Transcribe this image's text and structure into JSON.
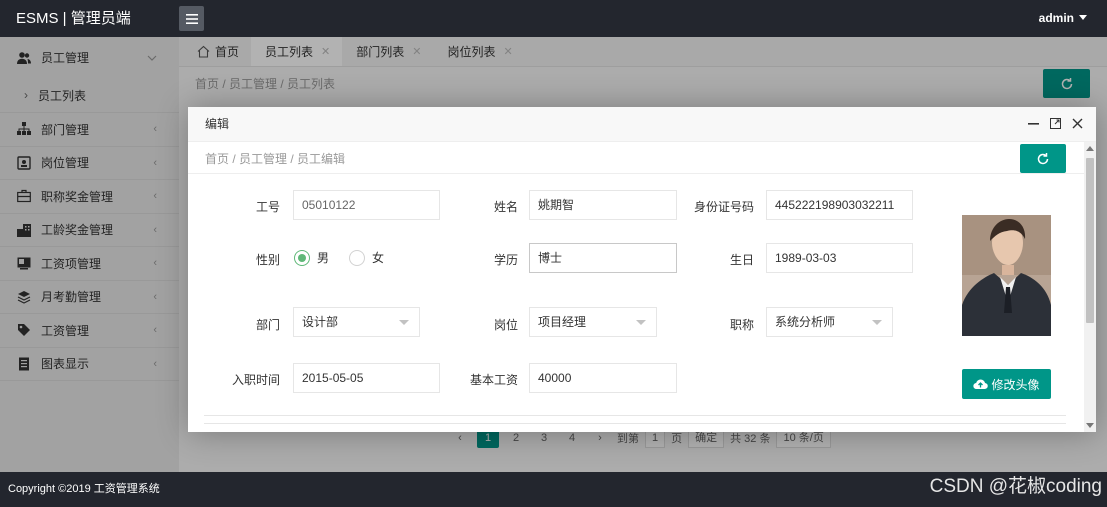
{
  "header": {
    "logo": "ESMS | 管理员端",
    "user": "admin"
  },
  "sidebar": {
    "groups": [
      {
        "label": "员工管理",
        "icon": "users-icon"
      },
      {
        "label": "部门管理",
        "icon": "sitemap-icon"
      },
      {
        "label": "岗位管理",
        "icon": "badge-icon"
      },
      {
        "label": "职称奖金管理",
        "icon": "briefcase-icon"
      },
      {
        "label": "工龄奖金管理",
        "icon": "building-icon"
      },
      {
        "label": "工资项管理",
        "icon": "card-icon"
      },
      {
        "label": "月考勤管理",
        "icon": "layers-icon"
      },
      {
        "label": "工资管理",
        "icon": "tag-icon"
      },
      {
        "label": "图表显示",
        "icon": "document-icon"
      }
    ],
    "sub_item": "员工列表"
  },
  "tabs": [
    {
      "label": "首页"
    },
    {
      "label": "员工列表"
    },
    {
      "label": "部门列表"
    },
    {
      "label": "岗位列表"
    }
  ],
  "main": {
    "breadcrumb": "首页  /  员工管理  /  员工列表",
    "pager": {
      "pages": [
        "1",
        "2",
        "3",
        "4"
      ],
      "goto_label": "到第",
      "goto_value": "1",
      "page_unit": "页",
      "confirm": "确定",
      "total": "共 32 条",
      "page_size": "10 条/页"
    }
  },
  "modal": {
    "title": "编辑",
    "breadcrumb": "首页  /  员工管理  /  员工编辑",
    "form": {
      "emp_no_label": "工号",
      "emp_no": "05010122",
      "name_label": "姓名",
      "name": "姚期智",
      "id_label": "身份证号码",
      "id_no": "445222198903032211",
      "gender_label": "性别",
      "male": "男",
      "female": "女",
      "edu_label": "学历",
      "edu": "博士",
      "birth_label": "生日",
      "birth": "1989-03-03",
      "dept_label": "部门",
      "dept": "设计部",
      "post_label": "岗位",
      "post": "项目经理",
      "title_label": "职称",
      "title": "系统分析师",
      "hire_label": "入职时间",
      "hire": "2015-05-05",
      "salary_label": "基本工资",
      "salary": "40000"
    },
    "avatar_button": "修改头像"
  },
  "footer": {
    "copyright": "Copyright ©2019 工资管理系统",
    "watermark": "CSDN @花椒coding"
  },
  "colors": {
    "accent": "#009688",
    "header": "#23262e",
    "radio": "#5fb878"
  }
}
